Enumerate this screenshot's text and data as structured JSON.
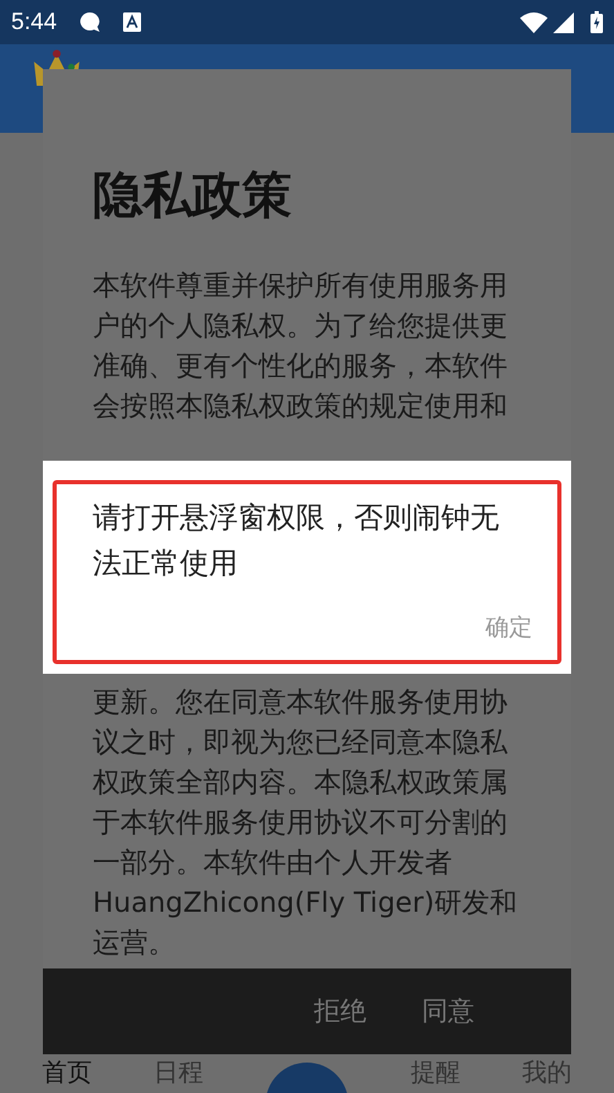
{
  "status_bar": {
    "time": "5:44"
  },
  "privacy_dialog": {
    "title": "隐私政策",
    "text_before": "本软件尊重并保护所有使用服务用户的个人隐私权。为了给您提供更准确、更有个性化的服务，本软件会按照本隐私权政策的规定使用和",
    "text_after": "更新。您在同意本软件服务使用协议之时，即视为您已经同意本隐私权政策全部内容。本隐私权政策属于本软件服务使用协议不可分割的一部分。本软件由个人开发者HuangZhicong(Fly Tiger)研发和运营。",
    "buttons": [
      {
        "label": "拒绝"
      },
      {
        "label": "同意"
      }
    ]
  },
  "alert": {
    "message": "请打开悬浮窗权限，否则闹钟无法正常使用",
    "button": "确定",
    "highlighted": true
  },
  "bottom_nav": [
    {
      "label": "首页",
      "selected": true
    },
    {
      "label": "日程",
      "selected": false
    },
    {
      "label": "提醒",
      "selected": false
    },
    {
      "label": "我的",
      "selected": false
    }
  ]
}
